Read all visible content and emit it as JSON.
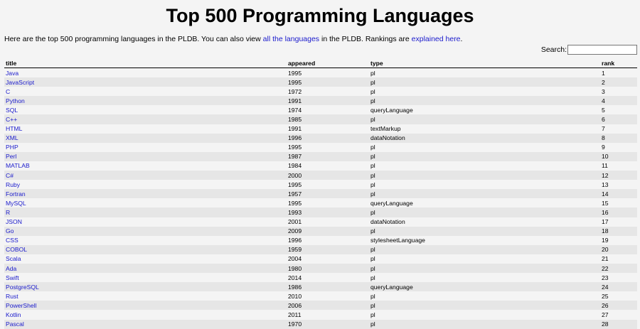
{
  "header": {
    "title": "Top 500 Programming Languages",
    "intro_prefix": "Here are the top 500 programming languages in the PLDB. You can also view ",
    "intro_link1": "all the languages",
    "intro_middle": " in the PLDB. Rankings are ",
    "intro_link2": "explained here",
    "intro_suffix": "."
  },
  "search": {
    "label": "Search:",
    "value": ""
  },
  "table": {
    "columns": [
      "title",
      "appeared",
      "type",
      "rank"
    ],
    "rows": [
      [
        "Java",
        "1995",
        "pl",
        "1"
      ],
      [
        "JavaScript",
        "1995",
        "pl",
        "2"
      ],
      [
        "C",
        "1972",
        "pl",
        "3"
      ],
      [
        "Python",
        "1991",
        "pl",
        "4"
      ],
      [
        "SQL",
        "1974",
        "queryLanguage",
        "5"
      ],
      [
        "C++",
        "1985",
        "pl",
        "6"
      ],
      [
        "HTML",
        "1991",
        "textMarkup",
        "7"
      ],
      [
        "XML",
        "1996",
        "dataNotation",
        "8"
      ],
      [
        "PHP",
        "1995",
        "pl",
        "9"
      ],
      [
        "Perl",
        "1987",
        "pl",
        "10"
      ],
      [
        "MATLAB",
        "1984",
        "pl",
        "11"
      ],
      [
        "C#",
        "2000",
        "pl",
        "12"
      ],
      [
        "Ruby",
        "1995",
        "pl",
        "13"
      ],
      [
        "Fortran",
        "1957",
        "pl",
        "14"
      ],
      [
        "MySQL",
        "1995",
        "queryLanguage",
        "15"
      ],
      [
        "R",
        "1993",
        "pl",
        "16"
      ],
      [
        "JSON",
        "2001",
        "dataNotation",
        "17"
      ],
      [
        "Go",
        "2009",
        "pl",
        "18"
      ],
      [
        "CSS",
        "1996",
        "stylesheetLanguage",
        "19"
      ],
      [
        "COBOL",
        "1959",
        "pl",
        "20"
      ],
      [
        "Scala",
        "2004",
        "pl",
        "21"
      ],
      [
        "Ada",
        "1980",
        "pl",
        "22"
      ],
      [
        "Swift",
        "2014",
        "pl",
        "23"
      ],
      [
        "PostgreSQL",
        "1986",
        "queryLanguage",
        "24"
      ],
      [
        "Rust",
        "2010",
        "pl",
        "25"
      ],
      [
        "PowerShell",
        "2006",
        "pl",
        "26"
      ],
      [
        "Kotlin",
        "2011",
        "pl",
        "27"
      ],
      [
        "Pascal",
        "1970",
        "pl",
        "28"
      ]
    ]
  },
  "colors": {
    "link": "#1a1acc",
    "row_alt": "#e6e6e6",
    "background": "#f4f4f4"
  }
}
